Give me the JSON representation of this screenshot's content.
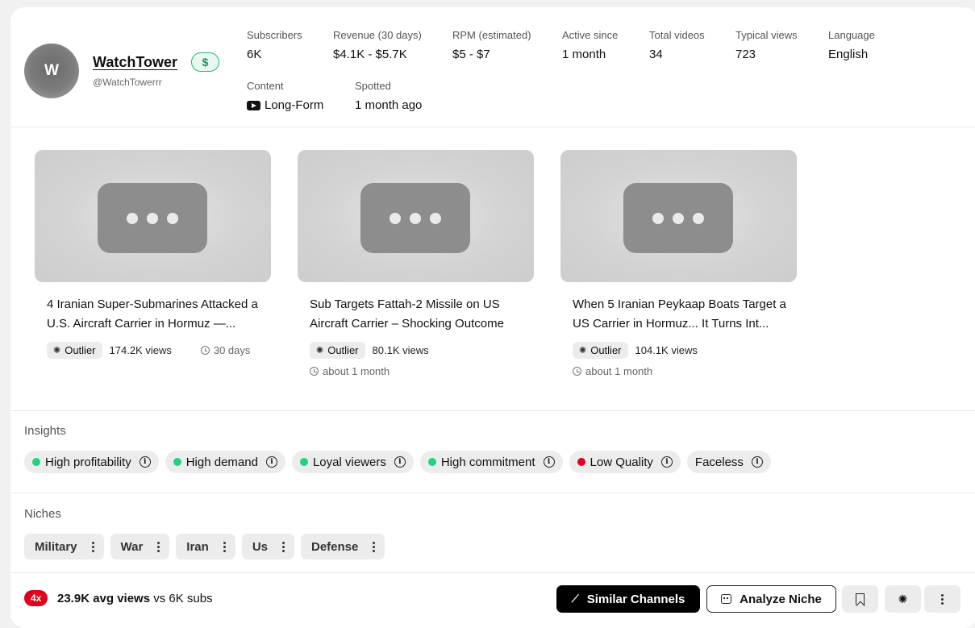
{
  "channel": {
    "avatar_letter": "W",
    "name": "WatchTower",
    "monetized_badge": "$",
    "handle": "@WatchTowerrr"
  },
  "stats": [
    {
      "label": "Subscribers",
      "value": "6K"
    },
    {
      "label": "Revenue (30 days)",
      "value": "$4.1K - $5.7K"
    },
    {
      "label": "RPM (estimated)",
      "value": "$5 - $7"
    },
    {
      "label": "Active since",
      "value": "1 month"
    },
    {
      "label": "Total videos",
      "value": "34"
    },
    {
      "label": "Typical views",
      "value": "723"
    },
    {
      "label": "Language",
      "value": "English"
    }
  ],
  "content": {
    "label": "Content",
    "value": "Long-Form",
    "icon": "youtube-icon"
  },
  "spotted": {
    "label": "Spotted",
    "value": "1 month ago"
  },
  "videos": [
    {
      "title": "4 Iranian Super-Submarines Attacked a U.S. Aircraft Carrier in Hormuz —...",
      "badge": "Outlier",
      "views": "174.2K views",
      "date": "30 days"
    },
    {
      "title": "Sub Targets Fattah-2 Missile on US Aircraft Carrier – Shocking Outcome",
      "badge": "Outlier",
      "views": "80.1K views",
      "date": "about 1 month"
    },
    {
      "title": "When 5 Iranian Peykaap Boats Target a US Carrier in Hormuz... It Turns Int...",
      "badge": "Outlier",
      "views": "104.1K views",
      "date": "about 1 month"
    }
  ],
  "insights": {
    "title": "Insights",
    "items": [
      {
        "label": "High profitability",
        "status_color": "#1ed47b"
      },
      {
        "label": "High demand",
        "status_color": "#1ed47b"
      },
      {
        "label": "Loyal viewers",
        "status_color": "#1ed47b"
      },
      {
        "label": "High commitment",
        "status_color": "#1ed47b"
      },
      {
        "label": "Low Quality",
        "status_color": "#e0001b"
      },
      {
        "label": "Faceless",
        "status_color": ""
      }
    ]
  },
  "niches": {
    "title": "Niches",
    "items": [
      "Military",
      "War",
      "Iran",
      "Us",
      "Defense"
    ]
  },
  "footer": {
    "ratio_badge": "4x",
    "avg_views": "23.9K avg views",
    "vs_subs": " vs 6K subs",
    "similar_label": "Similar Channels",
    "analyze_label": "Analyze Niche"
  },
  "colors": {
    "accent_dark": "#000000",
    "positive": "#1ed47b",
    "negative": "#e0001b",
    "monetized": "#1eb871"
  }
}
